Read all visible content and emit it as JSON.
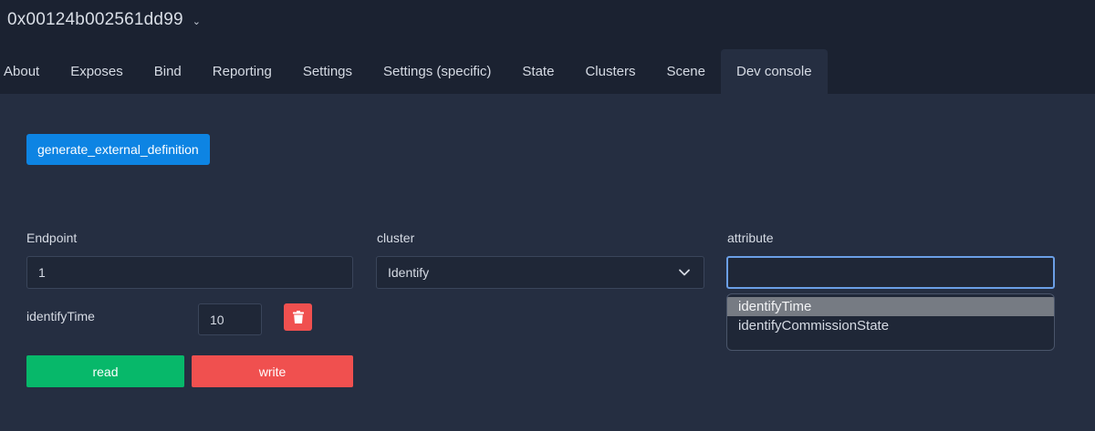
{
  "header": {
    "device_id": "0x00124b002561dd99",
    "caret": "⌄"
  },
  "tabs": [
    {
      "label": "About"
    },
    {
      "label": "Exposes"
    },
    {
      "label": "Bind"
    },
    {
      "label": "Reporting"
    },
    {
      "label": "Settings"
    },
    {
      "label": "Settings (specific)"
    },
    {
      "label": "State"
    },
    {
      "label": "Clusters"
    },
    {
      "label": "Scene"
    },
    {
      "label": "Dev console",
      "active": true
    }
  ],
  "dev_console": {
    "generate_button": "generate_external_definition",
    "endpoint_label": "Endpoint",
    "endpoint_value": "1",
    "cluster_label": "cluster",
    "cluster_value": "Identify",
    "attribute_label": "attribute",
    "attribute_value": "",
    "attribute_row": {
      "name": "identifyTime",
      "value": "10"
    },
    "read_button": "read",
    "write_button": "write",
    "attribute_options": [
      "identifyTime",
      "identifyCommissionState"
    ],
    "highlighted_option": "identifyTime"
  },
  "colors": {
    "background": "#1b2231",
    "panel": "#252e41",
    "primary": "#0d84e3",
    "success": "#07b86a",
    "danger": "#f0504f"
  }
}
